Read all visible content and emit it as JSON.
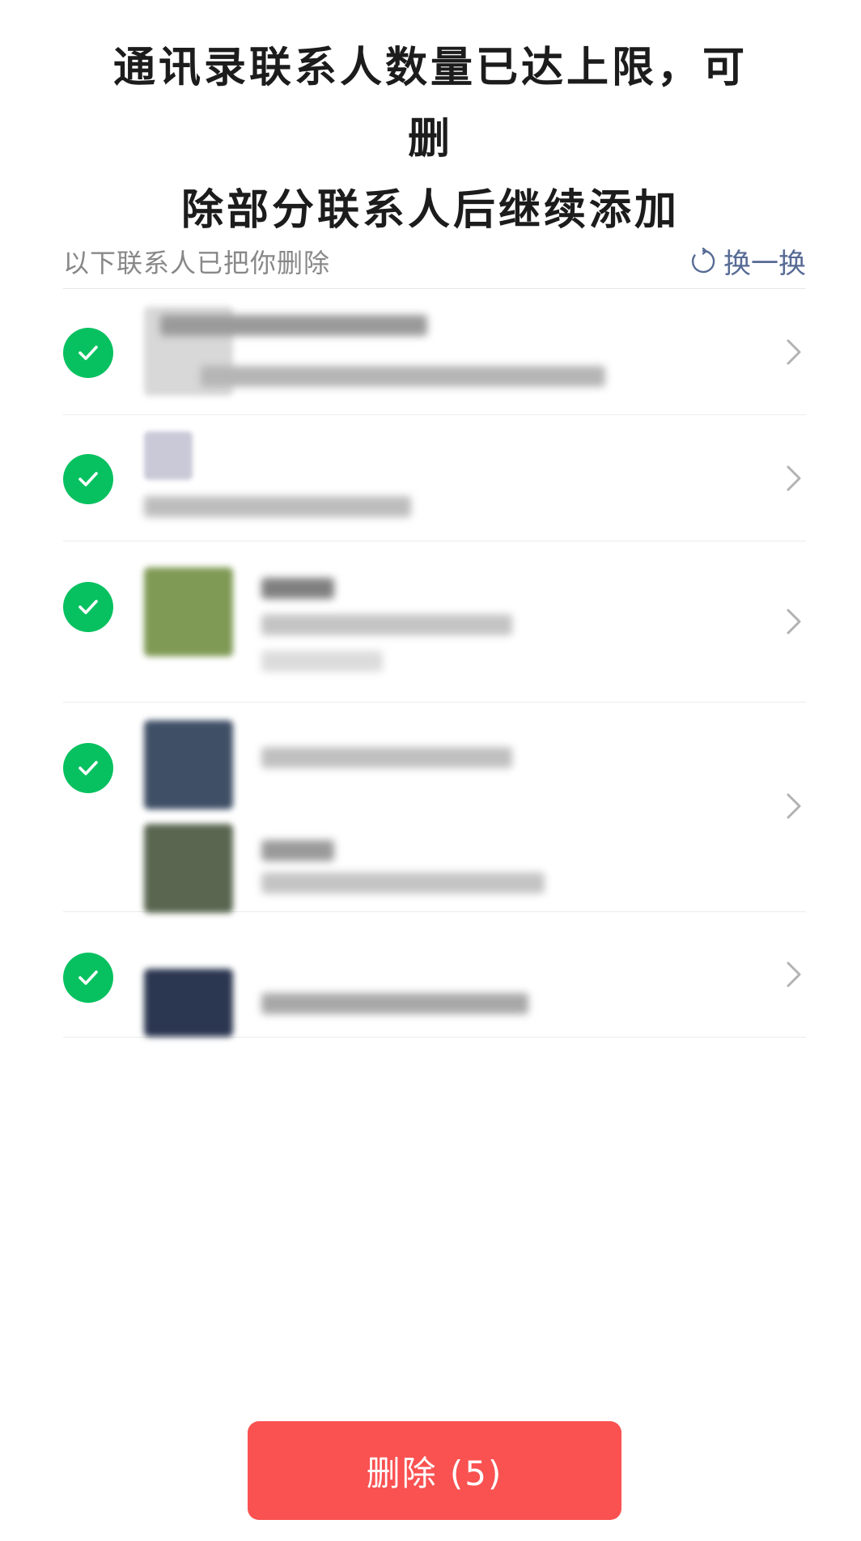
{
  "header": {
    "title_line1": "通讯录联系人数量已达上限，可删",
    "title_line2": "除部分联系人后继续添加"
  },
  "section": {
    "label": "以下联系人已把你删除",
    "refresh_label": "换一换"
  },
  "contacts": [
    {
      "selected": true
    },
    {
      "selected": true
    },
    {
      "selected": true
    },
    {
      "selected": true
    },
    {
      "selected": true
    }
  ],
  "colors": {
    "accent_green": "#07c160",
    "delete_red": "#fa5151",
    "link_blue": "#576b95"
  },
  "footer": {
    "delete_label": "删除 (5)"
  }
}
